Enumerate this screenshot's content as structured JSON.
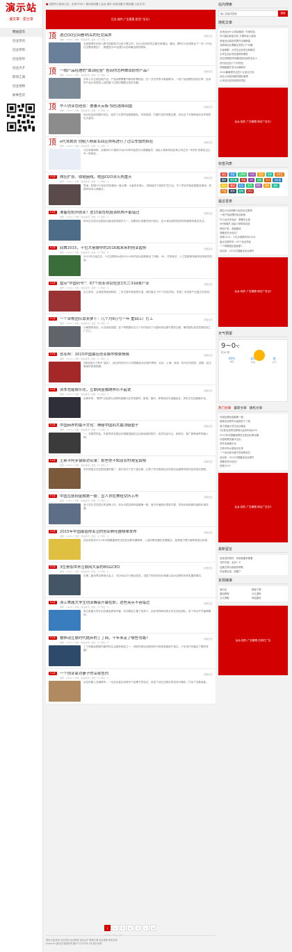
{
  "site": {
    "logo_title": "演示站",
    "logo_slogan": "诚文章 · 爱分享",
    "nav": [
      "网站首页",
      "创业资讯",
      "创业项目",
      "创业指导",
      "创业点子",
      "职场江湖",
      "创业视频",
      "故事百货"
    ]
  },
  "topbar": {
    "text": "这是可以滚动公告，支持HTML！移动端设置 | 后台-插件-系统设置-扩展设置-公告文字！"
  },
  "banner": {
    "text": "后台-插件-广告管理-首页广告位1"
  },
  "posts": [
    {
      "badge": "顶",
      "title": "透过QQ空间看95后的社交需求",
      "meta": "发布：admin | 分类：创业资讯 | 点击：8 | 评论：0",
      "read": "阅读全文",
      "excerpt": "当前微博在年轻人群中的影响力已经下降之时，对QQ空间的关注度日渐增加。最近，腾讯QQ空间推出了一份《95后社交需求报告》，数据显示95后是QQ空间最活跃的群体。",
      "thumb": "#6a7f9a"
    },
    {
      "badge": "顶",
      "title": "一线产品经理的\"血泪经验\" 告诉你怎样做出好的产品？",
      "meta": "发布：admin | 分类：创业资讯 | 点击：6 | 评论：0",
      "read": "阅读全文",
      "excerpt": "没有人天生就会做产品，产品经理需要不断地积累经验，在一次次失败中吸取教训。一线产品经理的经验分享，告诉你产品从构思到上线的整个过程中需要注意的问题。",
      "thumb": "#7b8a96"
    },
    {
      "badge": "顶",
      "title": "华人创业在硅谷：曹蕃天云板 惊险选择回国",
      "meta": "发布：admin | 分类：创业资讯 | 点击：5 | 评论：0",
      "read": "阅读全文",
      "excerpt": "他从硅谷回到国内创业，经历了从零开始搭建团队、寻找投资、打磨产品的完整过程，也见证了中美两地创业环境的巨大差异。",
      "thumb": "#8c8c8c"
    },
    {
      "badge": "顶",
      "title": "e代驾裁员 创始人杨家军回应称将进行了过山车般的疯狂",
      "meta": "发布：admin | 分类：创业资讯 | 点击：9 | 评论：0",
      "read": "阅读全文",
      "excerpt": "今日有媒体称，互联网O2O服务平台e代驾开始进行大规模裁员，创始人杨家军回应称公司过去一年的扩张像坐过山车一样疯狂。",
      "thumb": "#e7eef5"
    },
    {
      "badge": "01月",
      "title": "购狂扩张、收缩困线，校园O2O冰火两重天",
      "meta": "发布：admin | 分类：创业资讯 | 点击：7 | 评论：0",
      "read": "阅读全文",
      "excerpt": "导读：校园O2O创业项目曾经一度火爆，大量资本涌入，然而经历了疯狂扩张之后，不少项目开始收缩甚至倒闭，校园市场冰火两重天。",
      "thumb": "#5a4a4a"
    },
    {
      "badge": "01月",
      "title": "准备在杭州创业？这15家在杭投资机构不能错过",
      "meta": "发布：admin | 分类：创业资讯 | 点击：4 | 评论：0",
      "read": "阅读全文",
      "excerpt": "杭州正在成为全国创业最活跃的城市之一，如果你正准备在杭州创业，这15家活跃的投资机构值得你重点关注。",
      "thumb": "#4d6c88"
    },
    {
      "badge": "01月",
      "title": "回首2015，十位大佬眼中的2016成未来的创业趋势",
      "meta": "发布：admin | 分类：创业资讯 | 点击：6 | 评论：0",
      "read": "阅读全文",
      "excerpt": "2015年已经过去，十位互联网大佬对2016年的创业趋势做出了判断：VR、共享经济、人工智能等领域将迎来新的机会。",
      "thumb": "#3b6d3b"
    },
    {
      "badge": "01月",
      "title": "盘点\"中国符号\"：67个创业项目包含3大二手回收产业",
      "meta": "发布：admin | 分类：创业资讯 | 点击：3 | 评论：0",
      "read": "阅读全文",
      "excerpt": "近几年来，从淘宝闲鱼到转转，二手交易市场逐渐升温。我们盘点了67个创业项目，发现二手回收产业链正在形成。",
      "thumb": "#9a3333"
    },
    {
      "badge": "01月",
      "title": "一个草根团队靠卖萝卜：几个月8万亏一年 重回江厂打工",
      "meta": "发布：admin | 分类：创业资讯 | 点击：8 | 评论：0",
      "read": "阅读全文",
      "excerpt": "从萌想到真实，从试卖到加盟，这个草根团队在几个月内经历了从盈利到巨额亏损的过程，最终团队成员选择回到工厂打工。",
      "thumb": "#60656b"
    },
    {
      "badge": "01月",
      "title": "创业邦：2015中国最佳创业城市榜单揭晓",
      "meta": "发布：admin | 分类：创业资讯 | 点击：5 | 评论：0",
      "read": "阅读全文",
      "excerpt": "A股战前为了和平\"谁买\"。创业邦发布2015中国最佳创业城市榜单，北京、上海、深圳、杭州位列前四，成都、武汉等城市表现抢眼。",
      "thumb": "#a52828"
    },
    {
      "badge": "01月",
      "title": "资本也能娱乐化，互联网金融跨界乐不起说",
      "meta": "发布：admin | 分类：创业资讯 | 点击：4 | 评论：0",
      "read": "阅读全文",
      "excerpt": "近两年来，\"跨界\"已经成为互联网金融行业的关键词，影视、娱乐、体育纷纷与金融结合，资本正在加速娱乐化。",
      "thumb": "#2f2f3a"
    },
    {
      "badge": "01月",
      "title": "中国商界的最不文化：揭秘中国四大最顶级圈子",
      "meta": "发布：admin | 分类：创业资讯 | 点击：7 | 评论：0",
      "read": "阅读全文",
      "excerpt": "一、华夏同学会。华夏同学会是由中国最顶级的企业家组成的圈子，成员包括马云、柳传志、郭广昌等商界领袖人物。",
      "thumb": "#3b3b3b"
    },
    {
      "badge": "01月",
      "title": "王新平阿乡镇探访实录：那些你不知道农村淘宝真相",
      "meta": "发布：admin | 分类：创业资讯 | 点击：6 | 评论：0",
      "read": "阅读全文",
      "excerpt": "农村淘宝正在全国范围内推广，我们走访了多个县乡镇，记录了农村电商站点的真实运营情况和村民的真实感受。",
      "thumb": "#7a5a3a"
    },
    {
      "badge": "01月",
      "title": "中国互联网金融第一股：宜人贷在美纽交所上市",
      "meta": "发布：admin | 分类：创业资讯 | 点击：5 | 评论：0",
      "read": "阅读全文",
      "excerpt": "宜人贷正式在纽交所挂牌上市，成为中国互联网金融第一股，首日开盘股价表现平稳，市场对其前景持谨慎乐观态度。",
      "thumb": "#5d6e86"
    },
    {
      "badge": "01月",
      "title": "2015年中国最值得关注的创业孵化器榜单发布",
      "meta": "发布：admin | 分类：创业资讯 | 点击：4 | 评论：0",
      "read": "阅读全文",
      "excerpt": "创业邦发布2015年中国最值得关注的创业孵化器榜单，入选的孵化器在资源整合、投资能力等方面具有突出优势。",
      "thumb": "#e0c040"
    },
    {
      "badge": "01月",
      "title": "3位参加世界互联网大会的80后CEO",
      "meta": "发布：admin | 分类：创业资讯 | 点击：3 | 评论：0",
      "read": "阅读全文",
      "excerpt": "在第二届世界互联网大会上，3位80后CEO登台发言，讲述了他们的创业故事以及对互联网未来发展的看法。",
      "thumb": "#445566"
    },
    {
      "badge": "01月",
      "title": "浙江首届大学生创业峰会开幕在即，这些亮点不容错过",
      "meta": "发布：admin | 分类：创业资讯 | 点击：5 | 评论：0",
      "read": "阅读全文",
      "excerpt": "浙江首届大学生创业峰会即将开幕，本次峰会汇集了投资人、创业导师和优秀大学生创业团队，多个亮点环节值得期待。",
      "thumb": "#3a7dbf"
    },
    {
      "badge": "01月",
      "title": "被移动互联时代抛弃的丁丁网，十年来走了哪些弯路？",
      "meta": "发布：admin | 分类：创业资讯 | 点击：6 | 评论：0",
      "read": "阅读全文",
      "excerpt": "丁丁网曾经是国内最早的生活服务网站之一，然而在移动互联网时代却逐渐被用户遗忘，十年来它究竟走了哪些弯路？",
      "thumb": "#2e4a6a"
    },
    {
      "badge": "01月",
      "title": "一个创业家对妻子的深夜告白",
      "meta": "发布：admin | 分类：创业资讯 | 点击：8 | 评论：0",
      "read": "阅读全文",
      "excerpt": "创业的路上充满艰辛，一位创业者在深夜写下给妻子的告白，讲述了创业过程中的坚持与愧疚，打动了无数读者。",
      "thumb": "#b08a60"
    }
  ],
  "pager": [
    "1",
    "2",
    "3",
    "4",
    "5",
    "»",
    "»|"
  ],
  "footer": {
    "line1": "首页 创业资讯 创业项目 创业指导 创业点子 职场江湖 创业视频 故事百货",
    "line2": "Powered 演示站 版权所有 备ICP12345号-1号 统计代码",
    "watermark": "www.x-blog.com"
  },
  "right": {
    "search_title": "站内搜索",
    "search_placeholder": "输入关键词搜索",
    "search_button": "搜索",
    "random_title": "随机文章",
    "random": [
      "未来创业什么项目赚钱？市场项目",
      "华为推出新型手机 方便年轻人使用",
      "淘宝创业者如何提升店铺销量",
      "互联网创业需要注意的几个问题",
      "王者荣耀：大学生创业的五种模式",
      "大学生创业项目推荐有哪些",
      "创业初期如何快速找到合适的合伙人",
      "农村创业的几个好项目",
      "同城跑腿开发平台哪家好",
      "2016最值得关注的十大创业方向",
      "创业公司如何做好团队管理",
      "小本创业如何选择好项目"
    ],
    "ad1": "后台-插件-广告管理-侧边广告位1",
    "tags_title": "标签列表",
    "tags": [
      "创业",
      "项目",
      "互联网",
      "O2O",
      "投资",
      "电商",
      "大学生",
      "融资",
      "孵化器",
      "淘宝",
      "VR",
      "金融",
      "杭州",
      "创业者",
      "盘点",
      "移动",
      "社交",
      "农村",
      "跨界",
      "榜单",
      "团队",
      "产品",
      "故事",
      "营销",
      "CEO"
    ],
    "tag_colors": [
      "#e74c3c",
      "#3498db",
      "#2ecc71",
      "#9b59b6",
      "#f39c12",
      "#1abc9c",
      "#e67e22",
      "#34495e",
      "#16a085",
      "#c0392b",
      "#8e44ad",
      "#27ae60",
      "#d35400",
      "#2980b9",
      "#f1c40f"
    ],
    "latest_title": "最近发表",
    "latest": [
      "透过QQ空间看95后的社交需求",
      "一线产品经理的血泪经验",
      "华人创业在硅谷：曹蕃天云板",
      "e代驾裁员 创始人杨家军回应",
      "购狂扩张、收缩困线",
      "准备在杭州创业？",
      "回首2015，十位大佬眼中的2016",
      "盘点中国符号：67个创业项目",
      "一个草根团队靠卖萝卜",
      "创业邦：2015中国最佳创业城市"
    ],
    "ad2": "后台-插件-广告管理-侧边广告位2",
    "weather_title": "天气预报",
    "weather_temp": "9~0",
    "weather_unit": "℃",
    "weather_city": "杭州 晴",
    "weather_cells": [
      {
        "label": "湿度",
        "value": "46%"
      },
      {
        "label": "风向",
        "value": "北风"
      },
      {
        "label": "空气",
        "value": "良"
      }
    ],
    "tabs": [
      "热门文章",
      "最新文章",
      "随机文章"
    ],
    "hot": [
      "中国互联网金融第一股",
      "被移动互联时代抛弃的丁丁网",
      "浙江首届大学生创业峰会",
      "3位参加世界互联网大会的80后CEO",
      "2015年中国最值得关注的创业孵化器",
      "中国商界的最不文化",
      "资本也能娱乐化",
      "王新平阿乡镇探访实录",
      "一个创业家对妻子的深夜告白",
      "创业邦：2015中国最佳创业城市",
      "准备在杭州创业？",
      "回首2015"
    ],
    "ad3": "后台-插件-广告管理-侧边广告位3",
    "comments_title": "最新留言",
    "comments": [
      "信息说的很好，有用就要多看看",
      "写的不错，支持一下",
      "这篇文章对我很有帮助",
      "内容很实用，收藏了"
    ],
    "links_title": "友情链接",
    "links": [
      "演示站",
      "模板下载",
      "建站教程",
      "久久源码",
      "久久博客",
      "网站建设"
    ],
    "ad4": "后台-插件-广告管理-右侧栏广告"
  }
}
